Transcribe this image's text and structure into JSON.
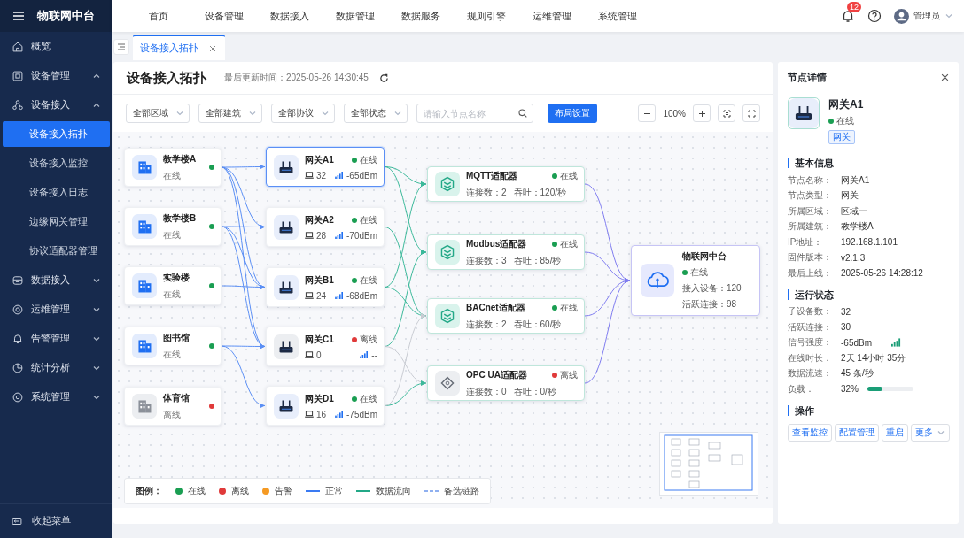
{
  "app": {
    "title": "物联网中台"
  },
  "top_nav": [
    "首页",
    "设备管理",
    "数据接入",
    "数据管理",
    "数据服务",
    "规则引擎",
    "运维管理",
    "系统管理"
  ],
  "header": {
    "notification_count": "12",
    "user": "管理员"
  },
  "sidebar": {
    "items": [
      {
        "label": "概览",
        "kind": "link"
      },
      {
        "label": "设备管理",
        "kind": "group",
        "expanded": true
      },
      {
        "label": "设备接入",
        "kind": "group",
        "expanded": true,
        "children": [
          {
            "label": "设备接入拓扑",
            "selected": true
          },
          {
            "label": "设备接入监控",
            "selected": false
          },
          {
            "label": "设备接入日志",
            "selected": false
          },
          {
            "label": "边缘网关管理",
            "selected": false
          },
          {
            "label": "协议适配器管理",
            "selected": false
          }
        ]
      },
      {
        "label": "数据接入",
        "kind": "group",
        "expanded": false
      },
      {
        "label": "运维管理",
        "kind": "group",
        "expanded": false
      },
      {
        "label": "告警管理",
        "kind": "group",
        "expanded": false
      },
      {
        "label": "统计分析",
        "kind": "group",
        "expanded": false
      },
      {
        "label": "系统管理",
        "kind": "group",
        "expanded": false
      }
    ],
    "collapse": "收起菜单"
  },
  "tabs": [
    {
      "label": "设备接入拓扑",
      "selected": true
    }
  ],
  "page": {
    "title": "设备接入拓扑",
    "updated": "最后更新时间：2025-05-26 14:30:45"
  },
  "toolbar": {
    "filters": [
      {
        "value": "全部区域"
      },
      {
        "value": "全部建筑"
      },
      {
        "value": "全部协议"
      },
      {
        "value": "全部状态"
      }
    ],
    "search": {
      "placeholder": "请输入节点名称"
    },
    "layout_button": "布局设置",
    "zoom": "100%"
  },
  "topology": {
    "buildings": [
      {
        "name": "教学楼A",
        "online": true,
        "status_label": "在线"
      },
      {
        "name": "教学楼B",
        "online": true,
        "status_label": "在线"
      },
      {
        "name": "实验楼",
        "online": true,
        "status_label": "在线"
      },
      {
        "name": "图书馆",
        "online": true,
        "status_label": "在线"
      },
      {
        "name": "体育馆",
        "online": false,
        "status_label": "离线"
      }
    ],
    "gateways": [
      {
        "name": "网关A1",
        "online": true,
        "status_label": "在线",
        "devices": "32",
        "signal": "-65dBm",
        "selected": true
      },
      {
        "name": "网关A2",
        "online": true,
        "status_label": "在线",
        "devices": "28",
        "signal": "-70dBm",
        "selected": false
      },
      {
        "name": "网关B1",
        "online": true,
        "status_label": "在线",
        "devices": "24",
        "signal": "-68dBm",
        "selected": false
      },
      {
        "name": "网关C1",
        "online": false,
        "status_label": "离线",
        "devices": "0",
        "signal": "--",
        "selected": false
      },
      {
        "name": "网关D1",
        "online": true,
        "status_label": "在线",
        "devices": "16",
        "signal": "-75dBm",
        "selected": false
      }
    ],
    "adapters": [
      {
        "name": "MQTT适配器",
        "online": true,
        "status_label": "在线",
        "connections": "连接数：2",
        "throughput": "吞吐：120/秒"
      },
      {
        "name": "Modbus适配器",
        "online": true,
        "status_label": "在线",
        "connections": "连接数：3",
        "throughput": "吞吐：85/秒"
      },
      {
        "name": "BACnet适配器",
        "online": true,
        "status_label": "在线",
        "connections": "连接数：2",
        "throughput": "吞吐：60/秒"
      },
      {
        "name": "OPC UA适配器",
        "online": false,
        "status_label": "离线",
        "connections": "连接数：0",
        "throughput": "吞吐：0/秒"
      }
    ],
    "platform": {
      "name": "物联网中台",
      "online": true,
      "status_label": "在线",
      "devices": "接入设备：120",
      "active": "活跃连接：98"
    }
  },
  "legend": {
    "title": "图例：",
    "items": [
      {
        "kind": "dot",
        "label": "在线",
        "color": "#1a9e52"
      },
      {
        "kind": "dot",
        "label": "离线",
        "color": "#e03a3a"
      },
      {
        "kind": "dot",
        "label": "告警",
        "color": "#f59a23"
      },
      {
        "kind": "line",
        "label": "正常",
        "color": "#3a7af2"
      },
      {
        "kind": "line",
        "label": "数据流向",
        "color": "#23a887"
      },
      {
        "kind": "dashed",
        "label": "备选链路",
        "color": "#8fb0f0"
      }
    ]
  },
  "detail": {
    "title": "节点详情",
    "name": "网关A1",
    "online": true,
    "status_label": "在线",
    "tag": "网关",
    "sections": [
      {
        "title": "基本信息",
        "rows": [
          {
            "label": "节点名称：",
            "value": "网关A1",
            "kind": "text"
          },
          {
            "label": "节点类型：",
            "value": "网关",
            "kind": "text"
          },
          {
            "label": "所属区域：",
            "value": "区域一",
            "kind": "text"
          },
          {
            "label": "所属建筑：",
            "value": "教学楼A",
            "kind": "text"
          },
          {
            "label": "IP地址：",
            "value": "192.168.1.101",
            "kind": "text"
          },
          {
            "label": "固件版本：",
            "value": "v2.1.3",
            "kind": "text"
          },
          {
            "label": "最后上线：",
            "value": "2025-05-26 14:28:12",
            "kind": "text"
          }
        ]
      },
      {
        "title": "运行状态",
        "rows": [
          {
            "label": "子设备数：",
            "value": "32",
            "kind": "text"
          },
          {
            "label": "活跃连接：",
            "value": "30",
            "kind": "text"
          },
          {
            "label": "信号强度：",
            "value": "-65dBm",
            "kind": "signal"
          },
          {
            "label": "在线时长：",
            "value": "2天 14小时 35分",
            "kind": "text"
          },
          {
            "label": "数据流速：",
            "value": "45 条/秒",
            "kind": "text"
          },
          {
            "label": "负载：",
            "value": "32%",
            "kind": "meter",
            "level": 0.32
          }
        ]
      }
    ],
    "actions": {
      "title": "操作",
      "buttons": [
        {
          "label": "查看监控",
          "kind": "plain"
        },
        {
          "label": "配置管理",
          "kind": "plain"
        },
        {
          "label": "重启",
          "kind": "plain"
        },
        {
          "label": "更多",
          "kind": "dropdown"
        }
      ]
    }
  }
}
